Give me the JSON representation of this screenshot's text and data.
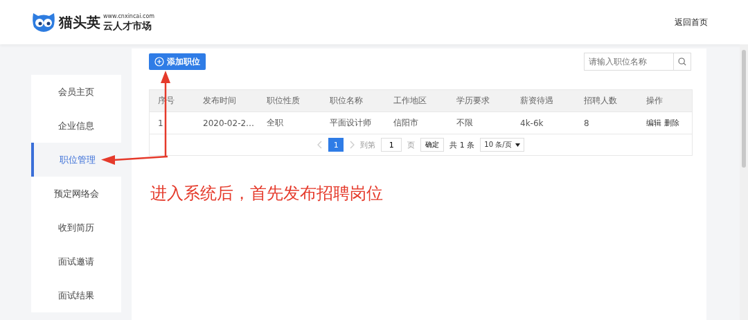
{
  "header": {
    "logo_name": "猫头英",
    "logo_url": "www.cnxincai.com",
    "logo_tagline": "云人才市场",
    "home_link": "返回首页"
  },
  "sidebar": {
    "items": [
      {
        "label": "会员主页",
        "selected": false
      },
      {
        "label": "企业信息",
        "selected": false
      },
      {
        "label": "职位管理",
        "selected": true
      },
      {
        "label": "预定网络会",
        "selected": false
      },
      {
        "label": "收到简历",
        "selected": false
      },
      {
        "label": "面试邀请",
        "selected": false
      },
      {
        "label": "面试结果",
        "selected": false
      }
    ]
  },
  "toolbar": {
    "add_button": "添加职位",
    "search": {
      "placeholder": "请输入职位名称"
    }
  },
  "table": {
    "columns": [
      "序号",
      "发布时间",
      "职位性质",
      "职位名称",
      "工作地区",
      "学历要求",
      "薪资待遇",
      "招聘人数",
      "操作"
    ],
    "rows": [
      {
        "cells": [
          "1",
          "2020-02-2…",
          "全职",
          "平面设计师",
          "信阳市",
          "不限",
          "4k-6k",
          "8"
        ],
        "actions": [
          "编辑",
          "删除"
        ]
      }
    ]
  },
  "pagination": {
    "pages": [
      {
        "label": "1",
        "selected": true
      }
    ],
    "goto_label": "到第",
    "goto_value": "1",
    "page_label": "页",
    "confirm": "确定",
    "total": "共 1 条",
    "page_size": "10 条/页"
  },
  "annotation": {
    "text": "进入系统后，首先发布招聘岗位"
  }
}
